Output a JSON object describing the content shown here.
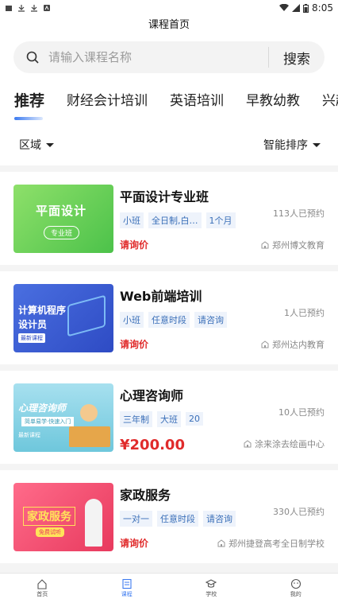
{
  "status_bar": {
    "time": "8:05",
    "left_icons": [
      "app-icon",
      "download-icon",
      "download-icon",
      "app-icon"
    ],
    "right_icons": [
      "wifi-icon",
      "signal-icon",
      "battery-icon"
    ]
  },
  "header": {
    "title": "课程首页"
  },
  "search": {
    "placeholder": "请输入课程名称",
    "button_label": "搜索"
  },
  "tabs": [
    {
      "label": "推荐",
      "active": true
    },
    {
      "label": "财经会计培训"
    },
    {
      "label": "英语培训"
    },
    {
      "label": "早教幼教"
    },
    {
      "label": "兴趣"
    }
  ],
  "filters": {
    "region_label": "区域",
    "sort_label": "智能排序"
  },
  "courses": [
    {
      "title": "平面设计专业班",
      "tags": [
        "小班",
        "全日制,白…",
        "1个月"
      ],
      "enrolled": "113人已预约",
      "price": "请询价",
      "school": "郑州博文教育",
      "thumb": {
        "line1": "平面设计",
        "pill": "专业班"
      }
    },
    {
      "title": "Web前端培训",
      "tags": [
        "小班",
        "任意时段",
        "请咨询"
      ],
      "enrolled": "1人已预约",
      "price": "请询价",
      "school": "郑州达内教育",
      "thumb": {
        "line1": "计算机程序",
        "line2": "设计员",
        "chip": "最新课程"
      }
    },
    {
      "title": "心理咨询师",
      "tags": [
        "三年制",
        "大班",
        "20"
      ],
      "enrolled": "10人已预约",
      "price": "¥200.00",
      "school": "涂来涂去绘画中心",
      "thumb": {
        "line1": "心理咨询师",
        "line2": "简单易学·快速入门",
        "chip": "最新课程"
      }
    },
    {
      "title": "家政服务",
      "tags": [
        "一对一",
        "任意时段",
        "请咨询"
      ],
      "enrolled": "330人已预约",
      "price": "请询价",
      "school": "郑州捷登高考全日制学校",
      "thumb": {
        "line1": "家政服务",
        "chip": "免费试听"
      }
    }
  ],
  "bottom_nav": [
    {
      "label": "首页",
      "icon": "home-icon"
    },
    {
      "label": "课程",
      "icon": "course-icon",
      "active": true
    },
    {
      "label": "学校",
      "icon": "school-icon"
    },
    {
      "label": "我的",
      "icon": "profile-icon"
    }
  ],
  "colors": {
    "accent": "#3d7bf0",
    "price": "#e02b2b",
    "tag_bg": "#eef3fb",
    "tag_text": "#3a6fb8"
  }
}
